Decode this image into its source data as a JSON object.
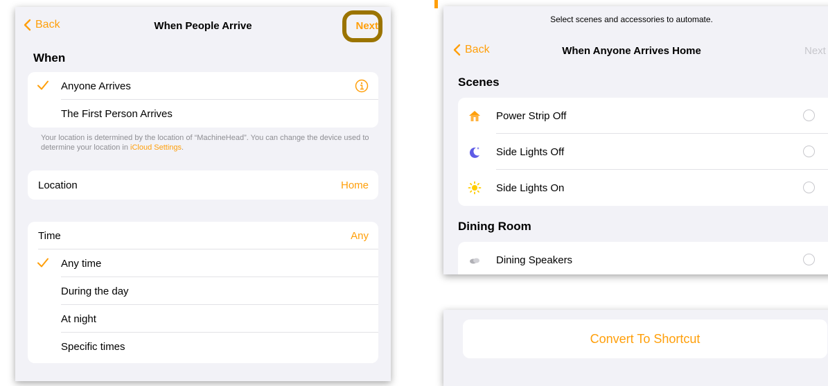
{
  "left": {
    "nav": {
      "back_label": "Back",
      "title": "When People Arrive",
      "next_label": "Next"
    },
    "when_header": "When",
    "arrival_options": [
      {
        "label": "Anyone Arrives",
        "selected": true
      },
      {
        "label": "The First Person Arrives",
        "selected": false
      }
    ],
    "footnote_text": "Your location is determined by the location of “MachineHead”. You can change the device used to determine your location in ",
    "footnote_link": "iCloud Settings",
    "footnote_end": ".",
    "location": {
      "label": "Location",
      "value": "Home"
    },
    "time": {
      "label": "Time",
      "value": "Any"
    },
    "time_options": [
      {
        "label": "Any time",
        "selected": true
      },
      {
        "label": "During the day",
        "selected": false
      },
      {
        "label": "At night",
        "selected": false
      },
      {
        "label": "Specific times",
        "selected": false
      }
    ]
  },
  "right": {
    "prompt": "Select scenes and accessories to automate.",
    "nav": {
      "back_label": "Back",
      "title": "When Anyone Arrives Home",
      "next_label": "Next"
    },
    "scenes_header": "Scenes",
    "scenes": [
      {
        "label": "Power Strip Off",
        "icon": "house-icon"
      },
      {
        "label": "Side Lights Off",
        "icon": "moon-icon"
      },
      {
        "label": "Side Lights On",
        "icon": "sun-icon"
      }
    ],
    "dining_header": "Dining Room",
    "dining": [
      {
        "label": "Dining Speakers",
        "icon": "speaker-icon"
      }
    ],
    "convert_label": "Convert To Shortcut"
  },
  "colors": {
    "accent": "#ff9f0a",
    "highlight_ring": "#9b7400",
    "background": "#f2f2f7"
  }
}
